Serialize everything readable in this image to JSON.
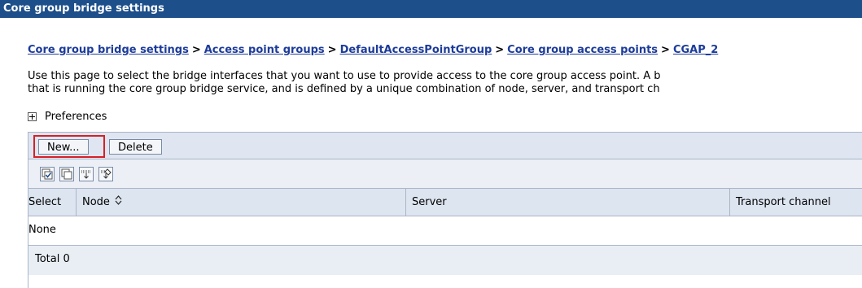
{
  "window": {
    "title": "Core group bridge settings"
  },
  "breadcrumb": {
    "items": [
      "Core group bridge settings",
      "Access point groups",
      "DefaultAccessPointGroup",
      "Core group access points",
      "CGAP_2"
    ],
    "separator": ">"
  },
  "description": {
    "line1": "Use this page to select the bridge interfaces that you want to use to provide access to the core group access point. A b",
    "line2": "that is running the core group bridge service, and is defined by a unique combination of node, server, and transport ch"
  },
  "preferences": {
    "label": "Preferences",
    "icon": "expand-plus-icon"
  },
  "toolbar": {
    "new_label": "New...",
    "delete_label": "Delete"
  },
  "icon_toolbar": {
    "icons": [
      "select-all-icon",
      "deselect-all-icon",
      "show-filter-icon",
      "clear-filter-icon"
    ]
  },
  "table": {
    "columns": [
      "Select",
      "Node",
      "Server",
      "Transport channel"
    ],
    "sort_icon": "sort-toggle-icon",
    "empty_text": "None",
    "total_text": "Total 0"
  },
  "colors": {
    "titlebar": "#1d4f8a",
    "link": "#1d3c99",
    "highlight": "#d81f25",
    "table_header": "#dde5f0"
  }
}
